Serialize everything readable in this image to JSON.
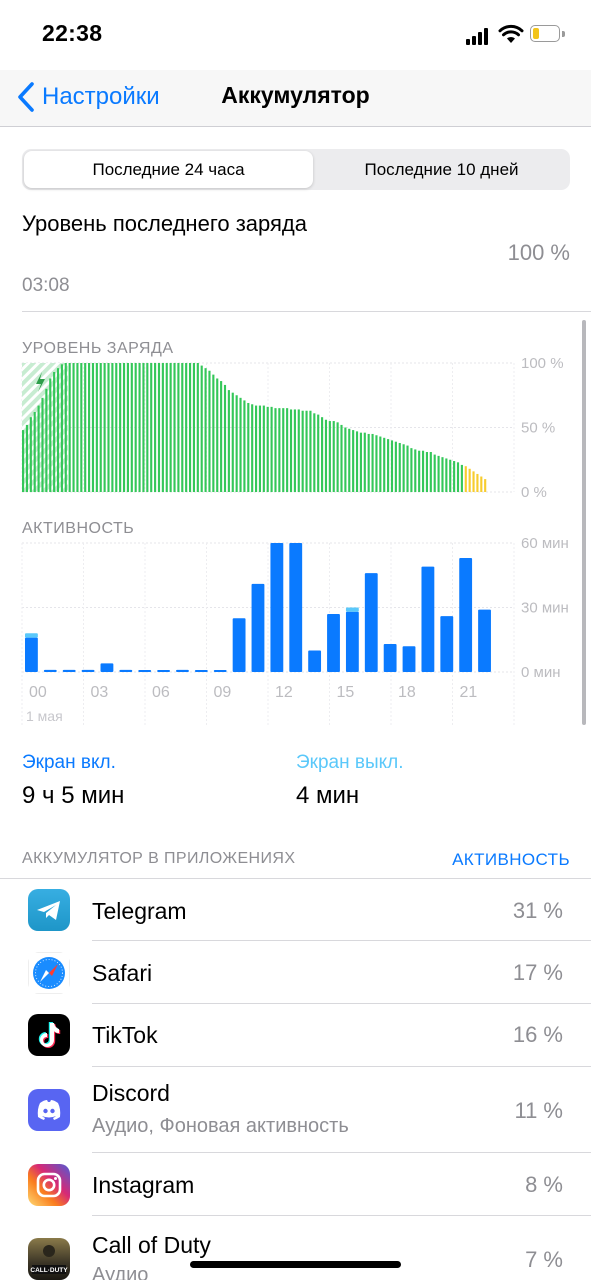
{
  "status_bar": {
    "time": "22:38"
  },
  "nav": {
    "back_label": "Настройки",
    "title": "Аккумулятор"
  },
  "segments": {
    "active": "Последние 24 часа",
    "inactive": "Последние 10 дней"
  },
  "last_charge": {
    "label": "Уровень последнего заряда",
    "time": "03:08",
    "value": "100 %"
  },
  "charts": {
    "level_title": "УРОВЕНЬ ЗАРЯДА",
    "level_ticks": [
      "100 %",
      "50 %",
      "0 %"
    ],
    "activity_title": "АКТИВНОСТЬ",
    "activity_ticks": [
      "60 мин",
      "30 мин",
      "0 мин"
    ],
    "x_ticks": [
      "00",
      "03",
      "06",
      "09",
      "12",
      "15",
      "18",
      "21"
    ],
    "date_label": "1 мая"
  },
  "chart_data": [
    {
      "type": "bar",
      "title": "УРОВЕНЬ ЗАРЯДА",
      "unit": "%",
      "ylim": [
        0,
        100
      ],
      "yticks": [
        0,
        50,
        100
      ],
      "colors": {
        "normal": "#34c759",
        "low": "#f7cc2e",
        "charging_hatch": "#34c759"
      },
      "charging_bars": 6,
      "values": [
        48,
        52,
        58,
        62,
        67,
        73,
        80,
        88,
        93,
        96,
        99,
        100,
        100,
        100,
        100,
        100,
        100,
        100,
        100,
        100,
        100,
        100,
        100,
        100,
        100,
        100,
        100,
        100,
        100,
        100,
        100,
        100,
        100,
        100,
        100,
        100,
        100,
        100,
        100,
        100,
        100,
        100,
        100,
        100,
        100,
        100,
        98,
        96,
        94,
        91,
        88,
        86,
        83,
        79,
        77,
        75,
        73,
        71,
        69,
        68,
        67,
        67,
        67,
        66,
        66,
        65,
        65,
        65,
        65,
        64,
        64,
        64,
        63,
        63,
        63,
        61,
        60,
        58,
        56,
        55,
        55,
        54,
        52,
        50,
        49,
        48,
        47,
        46,
        46,
        45,
        45,
        44,
        43,
        42,
        41,
        40,
        39,
        38,
        37,
        36,
        34,
        33,
        32,
        32,
        31,
        31,
        29,
        28,
        27,
        26,
        25,
        24,
        23,
        21,
        20,
        18,
        16,
        14,
        12,
        10
      ]
    },
    {
      "type": "bar",
      "title": "АКТИВНОСТЬ",
      "unit": "мин",
      "ylim": [
        0,
        60
      ],
      "yticks": [
        0,
        30,
        60
      ],
      "series": [
        {
          "name": "Экран вкл.",
          "color": "#0a7aff",
          "values": [
            16,
            1,
            1,
            1,
            4,
            1,
            0,
            0,
            1,
            0,
            0,
            25,
            41,
            60,
            60,
            10,
            27,
            28,
            46,
            13,
            12,
            49,
            26,
            53,
            29
          ]
        },
        {
          "name": "Экран выкл.",
          "color": "#5ac8fa",
          "values": [
            2,
            0,
            0,
            0,
            0,
            0,
            0,
            0,
            0,
            0,
            0,
            0,
            0,
            0,
            0,
            0,
            0,
            2,
            0,
            0,
            0,
            0,
            0,
            0,
            0
          ]
        }
      ],
      "x_tick_labels": [
        "00",
        "03",
        "06",
        "09",
        "12",
        "15",
        "18",
        "21"
      ],
      "date": "1 мая"
    }
  ],
  "screen_time": {
    "on_label": "Экран вкл.",
    "on_value": "9 ч 5 мин",
    "off_label": "Экран выкл.",
    "off_value": "4 мин"
  },
  "apps_section": {
    "header": "АККУМУЛЯТОР В ПРИЛОЖЕНИЯХ",
    "toggle": "АКТИВНОСТЬ"
  },
  "apps": [
    {
      "name": "Telegram",
      "sub": "",
      "pct": "31 %",
      "icon": "telegram-icon"
    },
    {
      "name": "Safari",
      "sub": "",
      "pct": "17 %",
      "icon": "safari-icon"
    },
    {
      "name": "TikTok",
      "sub": "",
      "pct": "16 %",
      "icon": "tiktok-icon"
    },
    {
      "name": "Discord",
      "sub": "Аудио, Фоновая активность",
      "pct": "11 %",
      "icon": "discord-icon"
    },
    {
      "name": "Instagram",
      "sub": "",
      "pct": "8 %",
      "icon": "instagram-icon"
    },
    {
      "name": "Call of Duty",
      "sub": "Аудио",
      "pct": "7 %",
      "icon": "call-of-duty-icon",
      "icon_text": "CALL·DUTY"
    }
  ]
}
